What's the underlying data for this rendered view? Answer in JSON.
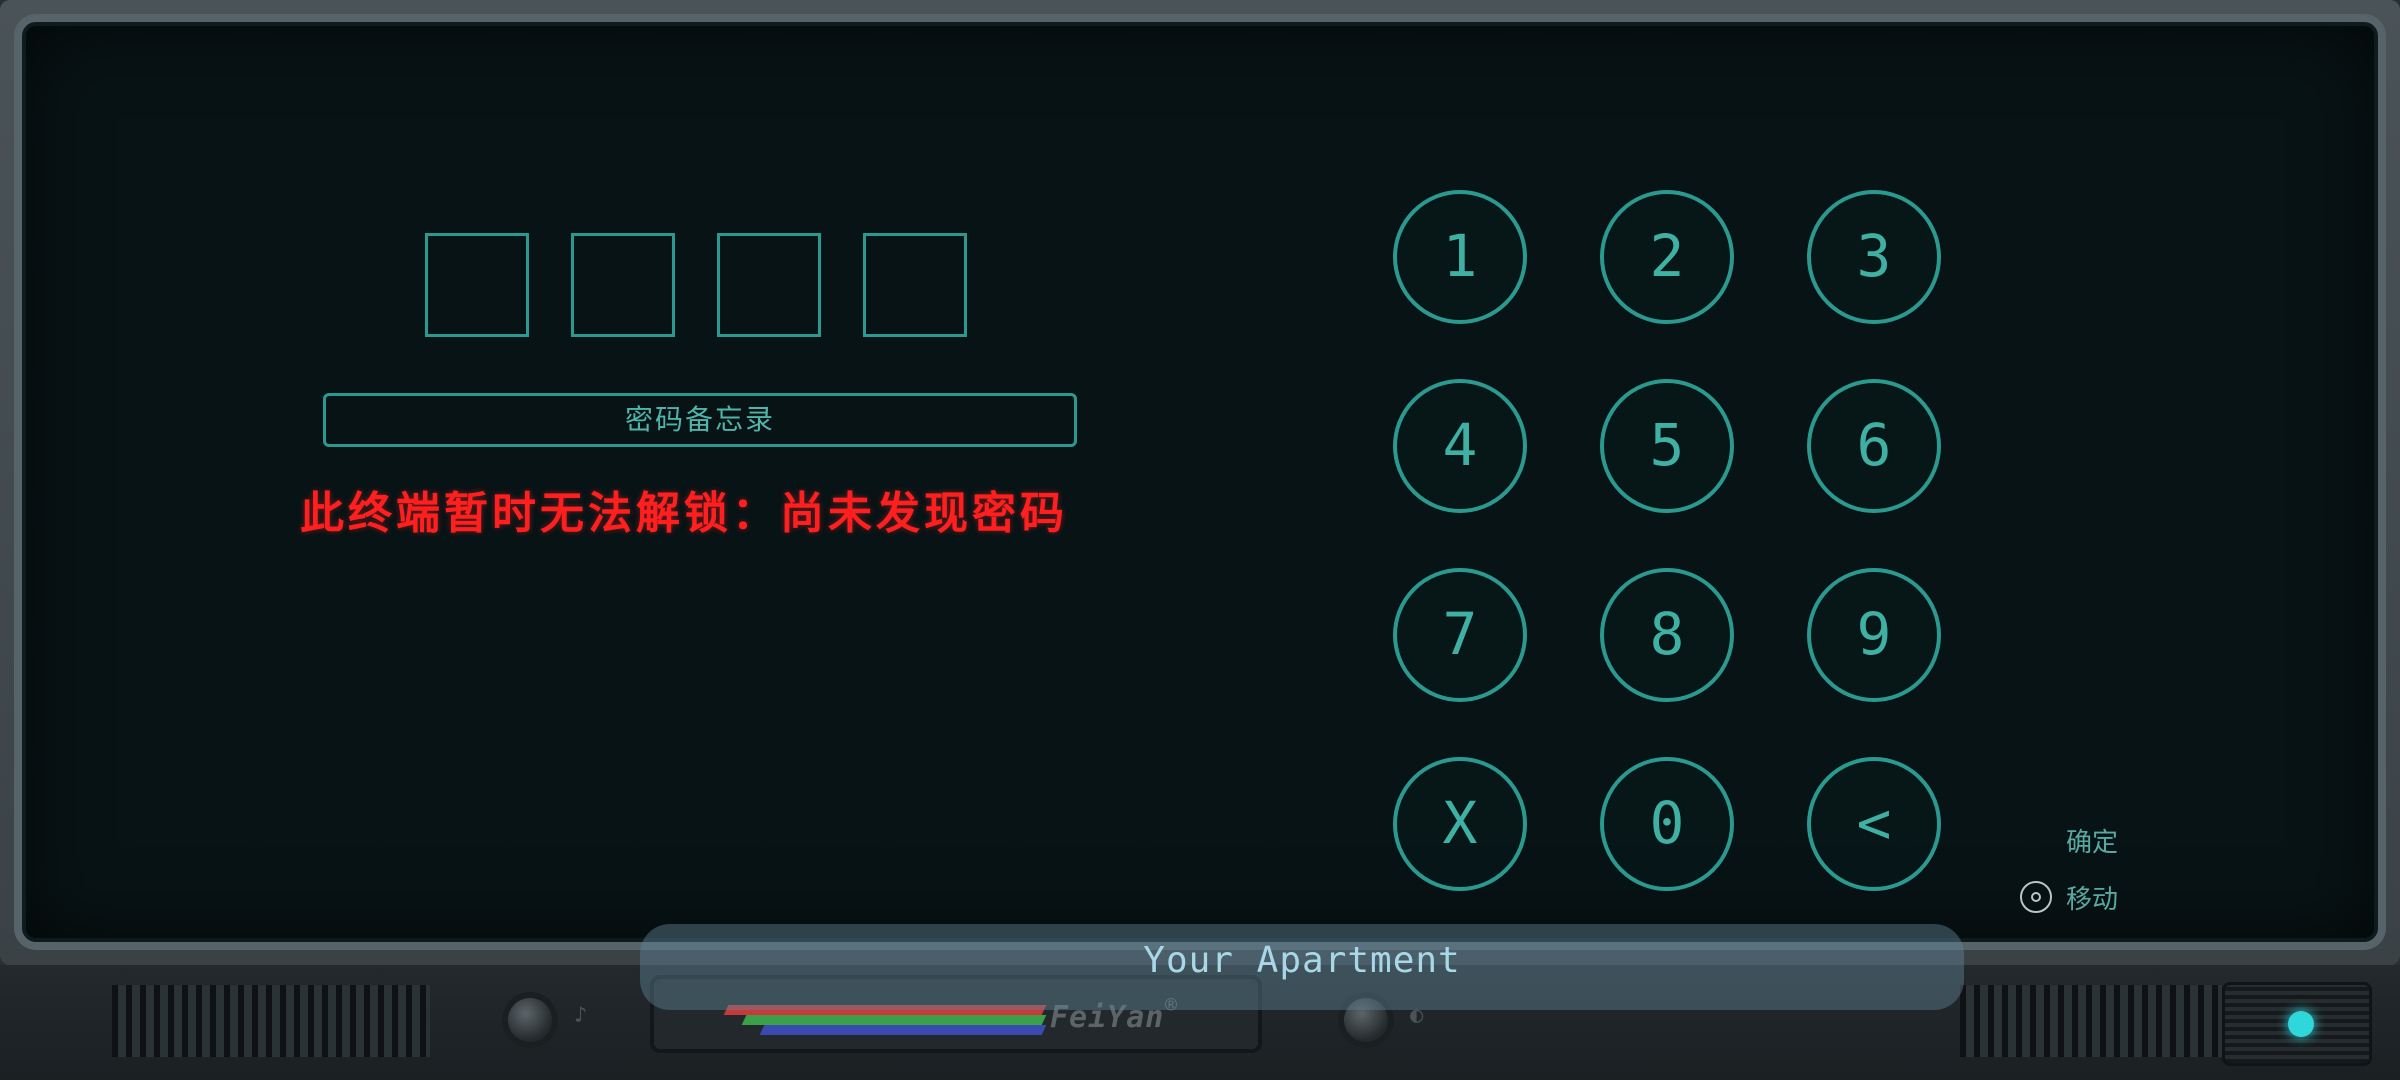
{
  "code_entry": {
    "slot_count": 4,
    "memo_button_label": "密码备忘录",
    "status_message": "此终端暂时无法解锁：尚未发现密码"
  },
  "keypad": {
    "keys": [
      "1",
      "2",
      "3",
      "4",
      "5",
      "6",
      "7",
      "8",
      "9",
      "X",
      "0",
      "<"
    ]
  },
  "controls": {
    "confirm_label": "确定",
    "move_label": "移动"
  },
  "location": {
    "name": "Your Apartment"
  },
  "console": {
    "brand": "FeiYan",
    "registered_mark": "®",
    "left_knob_symbol": "♪",
    "right_knob_symbol": "◐",
    "power_led_color": "#2fd6da"
  },
  "colors": {
    "accent": "#2a9a90",
    "error": "#ff1f1f",
    "screen_bg": "#081315"
  }
}
